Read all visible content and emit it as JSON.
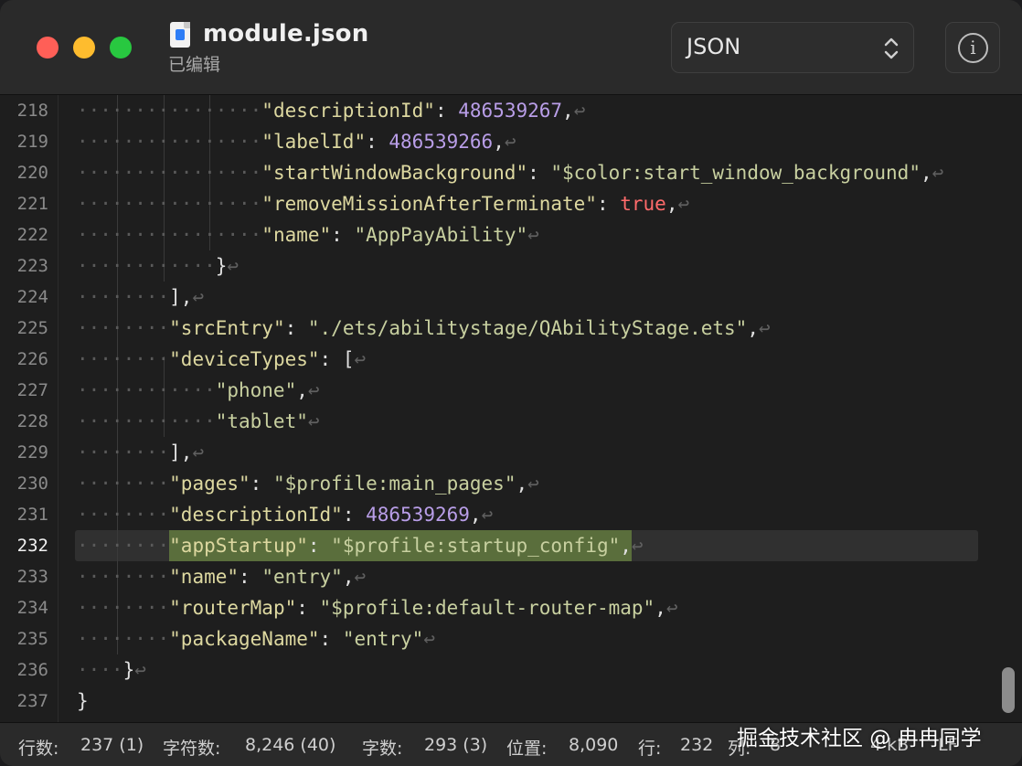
{
  "window": {
    "file_name": "module.json",
    "subtitle": "已编辑",
    "language": "JSON",
    "info_symbol": "i"
  },
  "editor": {
    "current_line": 232,
    "lines": [
      {
        "num": "218",
        "indent": 4,
        "tokens": [
          [
            "k",
            "\"descriptionId\""
          ],
          [
            "p",
            ": "
          ],
          [
            "n",
            "486539267"
          ],
          [
            "p",
            ","
          ]
        ]
      },
      {
        "num": "219",
        "indent": 4,
        "tokens": [
          [
            "k",
            "\"labelId\""
          ],
          [
            "p",
            ": "
          ],
          [
            "n",
            "486539266"
          ],
          [
            "p",
            ","
          ]
        ]
      },
      {
        "num": "220",
        "indent": 4,
        "tokens": [
          [
            "k",
            "\"startWindowBackground\""
          ],
          [
            "p",
            ": "
          ],
          [
            "s",
            "\"$color:start_window_background\""
          ],
          [
            "p",
            ","
          ]
        ]
      },
      {
        "num": "221",
        "indent": 4,
        "tokens": [
          [
            "k",
            "\"removeMissionAfterTerminate\""
          ],
          [
            "p",
            ": "
          ],
          [
            "b",
            "true"
          ],
          [
            "p",
            ","
          ]
        ]
      },
      {
        "num": "222",
        "indent": 4,
        "tokens": [
          [
            "k",
            "\"name\""
          ],
          [
            "p",
            ": "
          ],
          [
            "s",
            "\"AppPayAbility\""
          ]
        ]
      },
      {
        "num": "223",
        "indent": 3,
        "tokens": [
          [
            "p",
            "}"
          ]
        ]
      },
      {
        "num": "224",
        "indent": 2,
        "tokens": [
          [
            "p",
            "],"
          ]
        ]
      },
      {
        "num": "225",
        "indent": 2,
        "tokens": [
          [
            "k",
            "\"srcEntry\""
          ],
          [
            "p",
            ": "
          ],
          [
            "s",
            "\"./ets/abilitystage/QAbilityStage.ets\""
          ],
          [
            "p",
            ","
          ]
        ]
      },
      {
        "num": "226",
        "indent": 2,
        "tokens": [
          [
            "k",
            "\"deviceTypes\""
          ],
          [
            "p",
            ": ["
          ]
        ]
      },
      {
        "num": "227",
        "indent": 3,
        "tokens": [
          [
            "s",
            "\"phone\""
          ],
          [
            "p",
            ","
          ]
        ]
      },
      {
        "num": "228",
        "indent": 3,
        "tokens": [
          [
            "s",
            "\"tablet\""
          ]
        ]
      },
      {
        "num": "229",
        "indent": 2,
        "tokens": [
          [
            "p",
            "],"
          ]
        ]
      },
      {
        "num": "230",
        "indent": 2,
        "tokens": [
          [
            "k",
            "\"pages\""
          ],
          [
            "p",
            ": "
          ],
          [
            "s",
            "\"$profile:main_pages\""
          ],
          [
            "p",
            ","
          ]
        ]
      },
      {
        "num": "231",
        "indent": 2,
        "tokens": [
          [
            "k",
            "\"descriptionId\""
          ],
          [
            "p",
            ": "
          ],
          [
            "n",
            "486539269"
          ],
          [
            "p",
            ","
          ]
        ]
      },
      {
        "num": "232",
        "indent": 2,
        "tokens": [
          [
            "k",
            "\"appStartup\""
          ],
          [
            "p",
            ": "
          ],
          [
            "s",
            "\"$profile:startup_config\""
          ],
          [
            "p",
            ","
          ]
        ],
        "selected": true
      },
      {
        "num": "233",
        "indent": 2,
        "tokens": [
          [
            "k",
            "\"name\""
          ],
          [
            "p",
            ": "
          ],
          [
            "s",
            "\"entry\""
          ],
          [
            "p",
            ","
          ]
        ]
      },
      {
        "num": "234",
        "indent": 2,
        "tokens": [
          [
            "k",
            "\"routerMap\""
          ],
          [
            "p",
            ": "
          ],
          [
            "s",
            "\"$profile:default-router-map\""
          ],
          [
            "p",
            ","
          ]
        ]
      },
      {
        "num": "235",
        "indent": 2,
        "tokens": [
          [
            "k",
            "\"packageName\""
          ],
          [
            "p",
            ": "
          ],
          [
            "s",
            "\"entry\""
          ]
        ]
      },
      {
        "num": "236",
        "indent": 1,
        "tokens": [
          [
            "p",
            "}"
          ]
        ]
      },
      {
        "num": "237",
        "indent": 0,
        "tokens": [
          [
            "p",
            "}"
          ]
        ],
        "no_return": true
      }
    ]
  },
  "status": {
    "lines_label": "行数:",
    "lines_value": "237 (1)",
    "chars_label": "字符数:",
    "chars_value": "8,246 (40)",
    "words_label": "字数:",
    "words_value": "293 (3)",
    "position_label": "位置:",
    "position_value": "8,090",
    "row_label": "行:",
    "row_value": "232",
    "col_label": "列:",
    "col_value": "8",
    "size_value": "4 kB",
    "eol_value": "LF"
  },
  "watermark": "掘金技术社区 @ 冉冉同学",
  "colors": {
    "selection": "#5a6e3c",
    "key": "#ddd8a0",
    "string": "#c8d0a0",
    "number": "#b99ee8",
    "boolean": "#ff6b6b"
  }
}
